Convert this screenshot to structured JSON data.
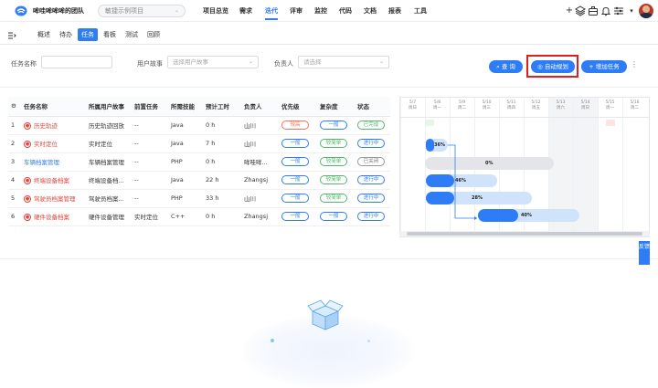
{
  "topbar": {
    "team_name": "哞哇哞哞哞的团队",
    "project_select": "敏捷示例项目",
    "nav": [
      "项目总览",
      "需求",
      "迭代",
      "评审",
      "监控",
      "代码",
      "文档",
      "报表",
      "工具"
    ],
    "active_nav": "迭代"
  },
  "subbar": {
    "tabs": [
      "概述",
      "待办",
      "任务",
      "看板",
      "测试",
      "回顾"
    ],
    "active_tab": "任务"
  },
  "filters": {
    "task_name_label": "任务名称",
    "task_name_value": "",
    "story_label": "用户故事",
    "story_placeholder": "选择用户故事",
    "owner_label": "负责人",
    "owner_placeholder": "请选择",
    "query_button": "查 询",
    "auto_plan_button": "自动规划",
    "add_task_button": "增加任务"
  },
  "table": {
    "headers": [
      "任务名称",
      "所属用户故事",
      "前置任务",
      "所需技能",
      "预计工时",
      "负责人",
      "优先级",
      "复杂度",
      "状态"
    ],
    "rows": [
      {
        "no": "1",
        "name": "历史轨迹",
        "story": "历史轨迹回放",
        "pre": "--",
        "skill": "Java",
        "hours": "0 h",
        "owner": "山川",
        "priority": "较高",
        "complexity": "一般",
        "status": "已完成"
      },
      {
        "no": "2",
        "name": "实时定位",
        "story": "实时定位",
        "pre": "--",
        "skill": "Java",
        "hours": "7 h",
        "owner": "山川",
        "priority": "一般",
        "complexity": "较简单",
        "status": "进行中"
      },
      {
        "no": "3",
        "name": "车辆档案管理",
        "story": "车辆档案管理",
        "pre": "--",
        "skill": "PHP",
        "hours": "0 h",
        "owner": "哞哇哞...",
        "priority": "一般",
        "complexity": "较简单",
        "status": "已关闭"
      },
      {
        "no": "4",
        "name": "终端设备档案",
        "story": "终端设备档...",
        "pre": "--",
        "skill": "Java",
        "hours": "22 h",
        "owner": "Zhangsj",
        "priority": "一般",
        "complexity": "较简单",
        "status": "进行中"
      },
      {
        "no": "5",
        "name": "驾驶员档案管理",
        "story": "驾驶员档案...",
        "pre": "--",
        "skill": "PHP",
        "hours": "33 h",
        "owner": "山川",
        "priority": "一般",
        "complexity": "较简单",
        "status": "进行中"
      },
      {
        "no": "6",
        "name": "硬件设备档案",
        "story": "硬件设备管理",
        "pre": "实时定位",
        "skill": "C++",
        "hours": "0 h",
        "owner": "Zhangsj",
        "priority": "一般",
        "complexity": "一般",
        "status": "进行中"
      }
    ]
  },
  "gantt": {
    "days": [
      {
        "date": "5/7",
        "weekday": "周日"
      },
      {
        "date": "5/8",
        "weekday": "周一"
      },
      {
        "date": "5/9",
        "weekday": "周二"
      },
      {
        "date": "5/10",
        "weekday": "周三"
      },
      {
        "date": "5/11",
        "weekday": "周四"
      },
      {
        "date": "5/12",
        "weekday": "周五"
      },
      {
        "date": "5/13",
        "weekday": "周六"
      },
      {
        "date": "5/14",
        "weekday": "周日"
      },
      {
        "date": "5/15",
        "weekday": "周一"
      },
      {
        "date": "5/16",
        "weekday": "周二"
      }
    ],
    "bars": [
      "36%",
      "0%",
      "46%",
      "28%",
      "40%"
    ]
  },
  "feedback": "反馈",
  "colors": {
    "accent": "#2f7df6",
    "highlight": "#e21d1d"
  }
}
